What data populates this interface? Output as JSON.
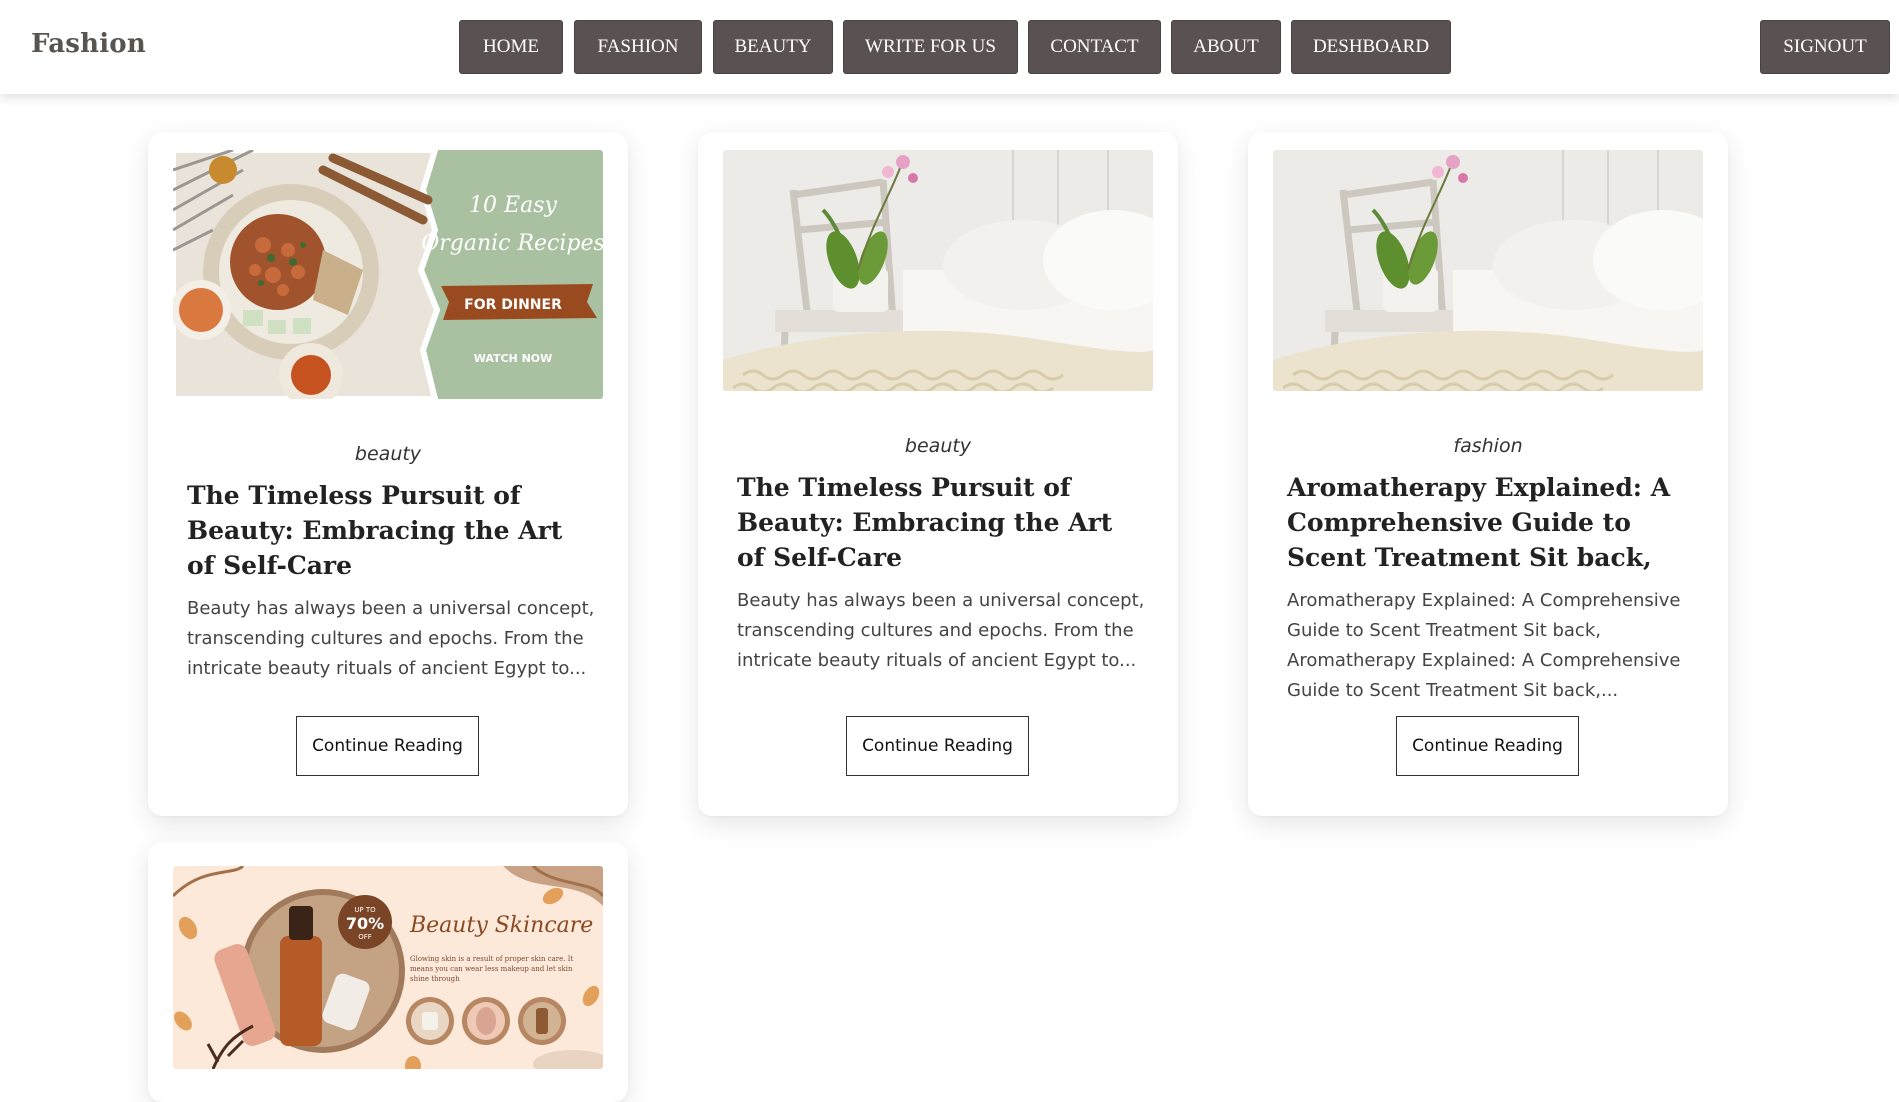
{
  "header": {
    "brand": "Fashion",
    "nav": [
      "HOME",
      "FASHION",
      "BEAUTY",
      "WRITE FOR US",
      "CONTACT",
      "ABOUT",
      "DESHBOARD"
    ],
    "signout_label": "SIGNOUT"
  },
  "cards": [
    {
      "category": "beauty",
      "title": "The Timeless Pursuit of Beauty: Embracing the Art of Self-Care",
      "excerpt": "Beauty has always been a universal concept, transcending cultures and epochs. From the intricate beauty rituals of ancient Egypt to...",
      "button": "Continue Reading",
      "image": {
        "line1": "10 Easy",
        "line2": "Organic Recipes",
        "banner": "FOR DINNER",
        "cta": "WATCH NOW"
      }
    },
    {
      "category": "beauty",
      "title": "The Timeless Pursuit of Beauty: Embracing the Art of Self-Care",
      "excerpt": "Beauty has always been a universal concept, transcending cultures and epochs. From the intricate beauty rituals of ancient Egypt to...",
      "button": "Continue Reading"
    },
    {
      "category": "fashion",
      "title": "Aromatherapy Explained: A Comprehensive Guide to Scent Treatment Sit back,",
      "excerpt": "Aromatherapy Explained: A Comprehensive Guide to Scent Treatment Sit back, Aromatherapy Explained: A Comprehensive Guide to Scent Treatment Sit back,...",
      "button": "Continue Reading"
    },
    {
      "image": {
        "badge_top": "UP TO",
        "badge_value": "70%",
        "badge_bottom": "OFF",
        "heading": "Beauty Skincare",
        "body": "Glowing skin is a result of proper skin care. It means you can wear less makeup and let skin shine through"
      }
    }
  ],
  "colors": {
    "nav_bg": "#5a5252",
    "brand": "#5a5450",
    "sage": "#a9c1a0",
    "rust": "#9a4a1f",
    "peach": "#fde9da"
  }
}
